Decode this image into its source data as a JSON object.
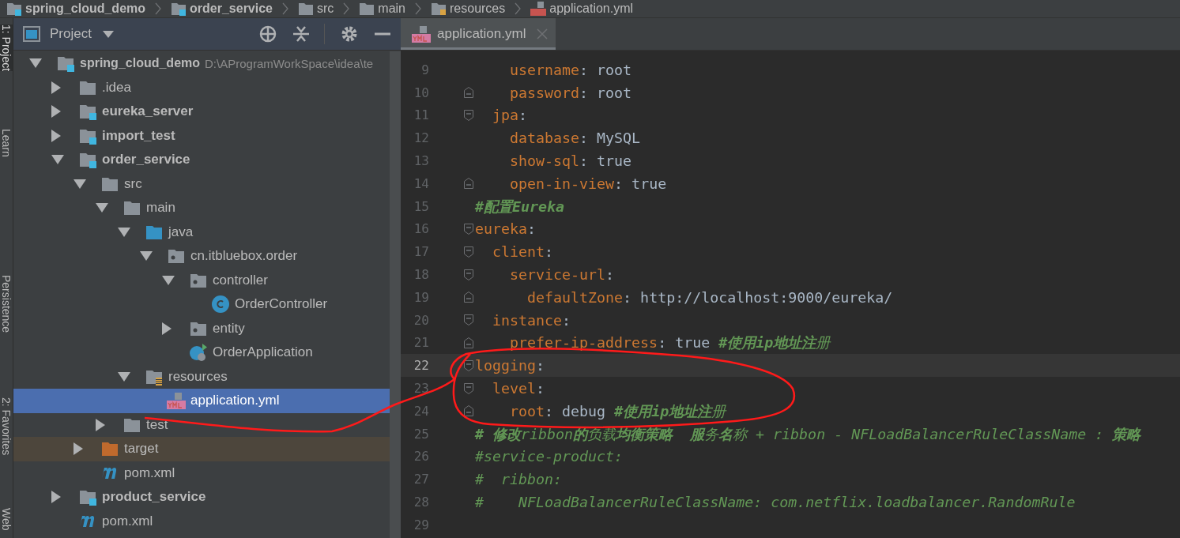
{
  "breadcrumbs": [
    {
      "label": "spring_cloud_demo",
      "kind": "module"
    },
    {
      "label": "order_service",
      "kind": "module"
    },
    {
      "label": "src",
      "kind": "folder"
    },
    {
      "label": "main",
      "kind": "folder"
    },
    {
      "label": "resources",
      "kind": "resources"
    },
    {
      "label": "application.yml",
      "kind": "yml"
    }
  ],
  "tool_strip": [
    {
      "label": "1: Project",
      "selected": true
    },
    {
      "label": "Learn",
      "selected": false
    },
    {
      "label": "Persistence",
      "selected": false
    },
    {
      "label": "2: Favorites",
      "selected": false
    },
    {
      "label": "Web",
      "selected": false
    }
  ],
  "project_panel": {
    "title": "Project",
    "tree": [
      {
        "label": "spring_cloud_demo",
        "kind": "module",
        "bold": true,
        "path": "D:\\AProgramWorkSpace\\idea\\te",
        "expanded": true,
        "selected": false,
        "children": [
          {
            "label": ".idea",
            "kind": "folder",
            "expanded": false,
            "selected": false
          },
          {
            "label": "eureka_server",
            "kind": "module",
            "bold": true,
            "expanded": false,
            "selected": false
          },
          {
            "label": "import_test",
            "kind": "module",
            "bold": true,
            "expanded": false,
            "selected": false
          },
          {
            "label": "order_service",
            "kind": "module",
            "bold": true,
            "expanded": true,
            "selected": false,
            "children": [
              {
                "label": "src",
                "kind": "folder",
                "expanded": true,
                "selected": false,
                "children": [
                  {
                    "label": "main",
                    "kind": "folder",
                    "expanded": true,
                    "selected": false,
                    "children": [
                      {
                        "label": "java",
                        "kind": "source",
                        "expanded": true,
                        "selected": false,
                        "children": [
                          {
                            "label": "cn.itbluebox.order",
                            "kind": "package",
                            "expanded": true,
                            "selected": false,
                            "children": [
                              {
                                "label": "controller",
                                "kind": "package",
                                "expanded": true,
                                "selected": false,
                                "children": [
                                  {
                                    "label": "OrderController",
                                    "kind": "class",
                                    "selected": false
                                  }
                                ]
                              },
                              {
                                "label": "entity",
                                "kind": "package",
                                "expanded": false,
                                "selected": false
                              },
                              {
                                "label": "OrderApplication",
                                "kind": "spring",
                                "selected": false
                              }
                            ]
                          }
                        ]
                      },
                      {
                        "label": "resources",
                        "kind": "resources",
                        "expanded": true,
                        "selected": false,
                        "children": [
                          {
                            "label": "application.yml",
                            "kind": "yml",
                            "selected": true
                          }
                        ]
                      }
                    ]
                  },
                  {
                    "label": "test",
                    "kind": "folder",
                    "expanded": false,
                    "selected": false
                  }
                ]
              },
              {
                "label": "target",
                "kind": "excluded",
                "excluded": true,
                "expanded": false,
                "selected": false
              },
              {
                "label": "pom.xml",
                "kind": "maven",
                "selected": false
              }
            ]
          },
          {
            "label": "product_service",
            "kind": "module",
            "bold": true,
            "expanded": false,
            "selected": false
          },
          {
            "label": "pom.xml",
            "kind": "maven",
            "selected": false
          }
        ]
      }
    ]
  },
  "editor": {
    "tabs": [
      {
        "label": "application.yml",
        "selected": true
      }
    ],
    "lines": [
      {
        "number": "9",
        "kind": "plain",
        "tokens": [
          {
            "kind": "key",
            "text": "    username"
          },
          {
            "kind": "plain",
            "text": ": root"
          }
        ]
      },
      {
        "number": "10",
        "kind": "fold-end",
        "tokens": [
          {
            "kind": "key",
            "text": "    password"
          },
          {
            "kind": "plain",
            "text": ": root"
          }
        ]
      },
      {
        "number": "11",
        "kind": "fold-start",
        "tokens": [
          {
            "kind": "key",
            "text": "  jpa"
          },
          {
            "kind": "plain",
            "text": ":"
          }
        ]
      },
      {
        "number": "12",
        "kind": "plain",
        "tokens": [
          {
            "kind": "key",
            "text": "    database"
          },
          {
            "kind": "plain",
            "text": ": MySQL"
          }
        ]
      },
      {
        "number": "13",
        "kind": "plain",
        "tokens": [
          {
            "kind": "key",
            "text": "    show-sql"
          },
          {
            "kind": "plain",
            "text": ": true"
          }
        ]
      },
      {
        "number": "14",
        "kind": "fold-end",
        "tokens": [
          {
            "kind": "key",
            "text": "    open-in-view"
          },
          {
            "kind": "plain",
            "text": ": true"
          }
        ]
      },
      {
        "number": "15",
        "kind": "plain",
        "tokens": [
          {
            "kind": "bold-comment",
            "text": "#配置Eureka"
          }
        ]
      },
      {
        "number": "16",
        "kind": "fold-start",
        "tokens": [
          {
            "kind": "key",
            "text": "eureka"
          },
          {
            "kind": "plain",
            "text": ":"
          }
        ]
      },
      {
        "number": "17",
        "kind": "fold-start",
        "tokens": [
          {
            "kind": "key",
            "text": "  client"
          },
          {
            "kind": "plain",
            "text": ":"
          }
        ]
      },
      {
        "number": "18",
        "kind": "fold-start",
        "tokens": [
          {
            "kind": "key",
            "text": "    service-url"
          },
          {
            "kind": "plain",
            "text": ":"
          }
        ]
      },
      {
        "number": "19",
        "kind": "fold-end",
        "tokens": [
          {
            "kind": "key",
            "text": "      defaultZone"
          },
          {
            "kind": "plain",
            "text": ": http://localhost:9000/eureka/"
          }
        ]
      },
      {
        "number": "20",
        "kind": "fold-start",
        "tokens": [
          {
            "kind": "key",
            "text": "  instance"
          },
          {
            "kind": "plain",
            "text": ":"
          }
        ]
      },
      {
        "number": "21",
        "kind": "fold-end",
        "tokens": [
          {
            "kind": "key",
            "text": "    prefer-ip-address"
          },
          {
            "kind": "plain",
            "text": ": true "
          },
          {
            "kind": "comment",
            "text": "**#使用ip地址注**册"
          }
        ]
      },
      {
        "number": "22",
        "kind": "fold-start",
        "current": true,
        "tokens": [
          {
            "kind": "key",
            "text": "logging"
          },
          {
            "kind": "plain",
            "text": ":"
          }
        ]
      },
      {
        "number": "23",
        "kind": "fold-start",
        "tokens": [
          {
            "kind": "key",
            "text": "  level"
          },
          {
            "kind": "plain",
            "text": ":"
          }
        ]
      },
      {
        "number": "24",
        "kind": "fold-end",
        "tokens": [
          {
            "kind": "key",
            "text": "    root"
          },
          {
            "kind": "plain",
            "text": ": debug "
          },
          {
            "kind": "comment",
            "text": "**#使用ip地址注**册"
          }
        ]
      },
      {
        "number": "25",
        "kind": "plain",
        "tokens": [
          {
            "kind": "comment",
            "text": "**# 修改**ribbon**的**负载**均衡策略  服**务**名**称 + ribbon - NFLoadBalancerRuleClassName : **策略**"
          }
        ]
      },
      {
        "number": "26",
        "kind": "plain",
        "tokens": [
          {
            "kind": "comment",
            "text": "#service-product:"
          }
        ]
      },
      {
        "number": "27",
        "kind": "plain",
        "tokens": [
          {
            "kind": "comment",
            "text": "#  ribbon:"
          }
        ]
      },
      {
        "number": "28",
        "kind": "plain",
        "tokens": [
          {
            "kind": "comment",
            "text": "#    NFLoadBalancerRuleClassName: com.netflix.loadbalancer.RandomRule"
          }
        ]
      },
      {
        "number": "29",
        "kind": "plain"
      }
    ]
  }
}
